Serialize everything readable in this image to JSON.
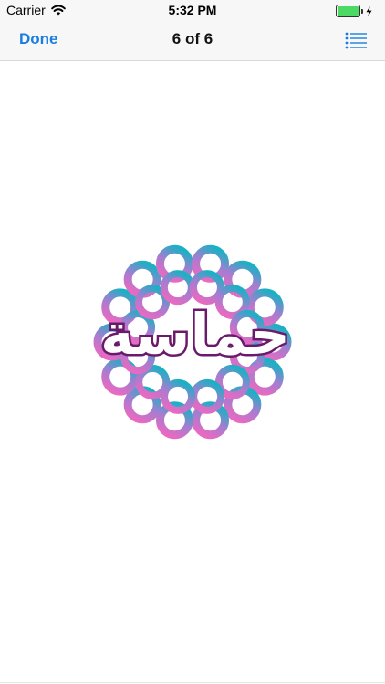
{
  "status_bar": {
    "carrier": "Carrier",
    "time": "5:32 PM",
    "battery_level": 1.0,
    "battery_color": "#4cd964"
  },
  "nav": {
    "done_label": "Done",
    "title": "6 of 6",
    "accent_color": "#1a7ee0",
    "list_icon": "list-icon"
  },
  "content": {
    "logo_text": "حماسة",
    "logo_colors": [
      "#1ab1c4",
      "#a37ed0",
      "#e86ac2",
      "#6a1a6b"
    ]
  }
}
